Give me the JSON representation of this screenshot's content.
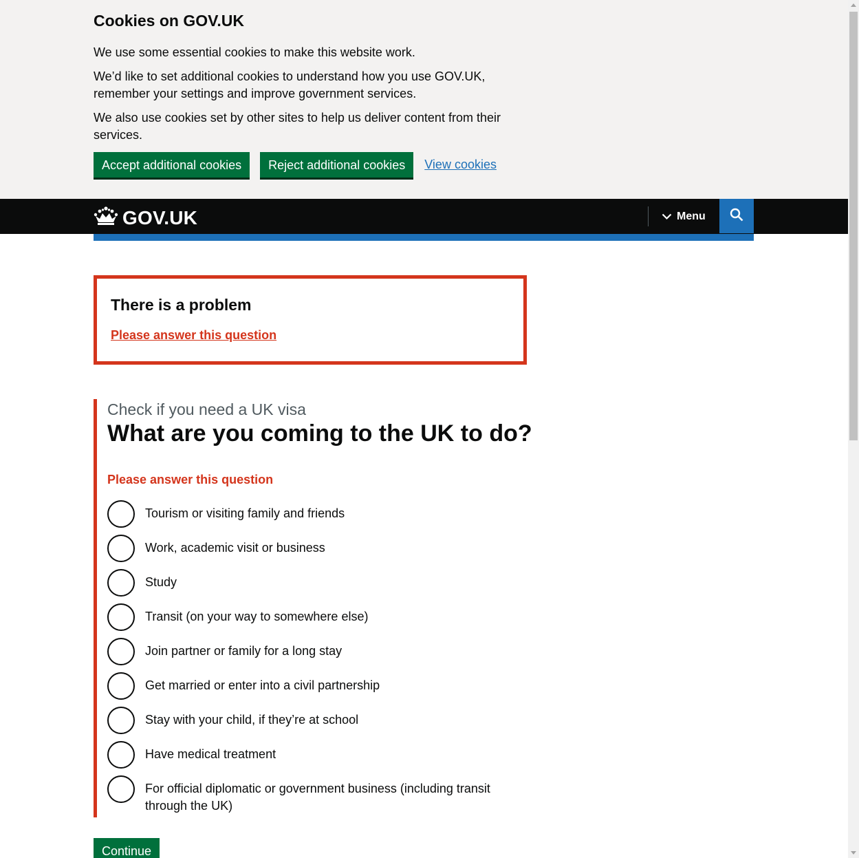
{
  "cookie_banner": {
    "title": "Cookies on GOV.UK",
    "paragraphs": [
      "We use some essential cookies to make this website work.",
      "We’d like to set additional cookies to understand how you use GOV.UK, remember your settings and improve government services.",
      "We also use cookies set by other sites to help us deliver content from their services."
    ],
    "accept_label": "Accept additional cookies",
    "reject_label": "Reject additional cookies",
    "view_label": "View cookies"
  },
  "header": {
    "logo_text": "GOV.UK",
    "menu_label": "Menu",
    "logo_icon": "crown-icon",
    "search_icon": "search-icon"
  },
  "error_summary": {
    "title": "There is a problem",
    "link": "Please answer this question"
  },
  "question": {
    "caption": "Check if you need a UK visa",
    "title": "What are you coming to the UK to do?",
    "error_message": "Please answer this question",
    "options": [
      "Tourism or visiting family and friends",
      "Work, academic visit or business",
      "Study",
      "Transit (on your way to somewhere else)",
      "Join partner or family for a long stay",
      "Get married or enter into a civil partnership",
      "Stay with your child, if they’re at school",
      "Have medical treatment",
      "For official diplomatic or government business (including transit through the UK)"
    ]
  },
  "continue_label": "Continue",
  "colors": {
    "brand_green": "#00703c",
    "error_red": "#d4351c",
    "link_blue": "#1d70b8",
    "header_black": "#0b0c0c",
    "banner_grey": "#f3f2f1"
  }
}
